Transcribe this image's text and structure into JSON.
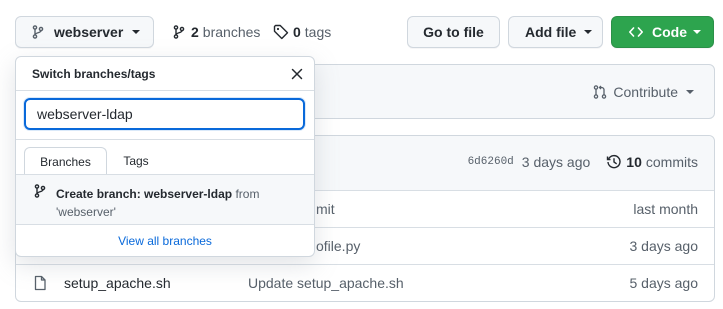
{
  "branch_button": {
    "label": "webserver"
  },
  "stats": {
    "branches_count": "2",
    "branches_label": "branches",
    "tags_count": "0",
    "tags_label": "tags"
  },
  "toolbar": {
    "go_to_file": "Go to file",
    "add_file": "Add file",
    "code": "Code"
  },
  "contribute": {
    "label": "Contribute"
  },
  "latest_commit": {
    "sha": "6d6260d",
    "time": "3 days ago",
    "commits_count": "10",
    "commits_label": "commits"
  },
  "files": [
    {
      "name": "",
      "message": "mit",
      "time": "last month"
    },
    {
      "name": "",
      "message": "ofile.py",
      "time": "3 days ago"
    },
    {
      "name": "setup_apache.sh",
      "message": "Update setup_apache.sh",
      "time": "5 days ago"
    }
  ],
  "dropdown": {
    "title": "Switch branches/tags",
    "filter_value": "webserver-ldap",
    "tabs": [
      "Branches",
      "Tags"
    ],
    "create_branch_prefix": "Create branch:",
    "create_branch_name": "webserver-ldap",
    "create_branch_from_word": "from",
    "create_branch_source": "'webserver'",
    "view_all": "View all branches"
  },
  "colors": {
    "primary_green": "#2da44e",
    "link_blue": "#0969da",
    "border": "#d0d7de"
  }
}
